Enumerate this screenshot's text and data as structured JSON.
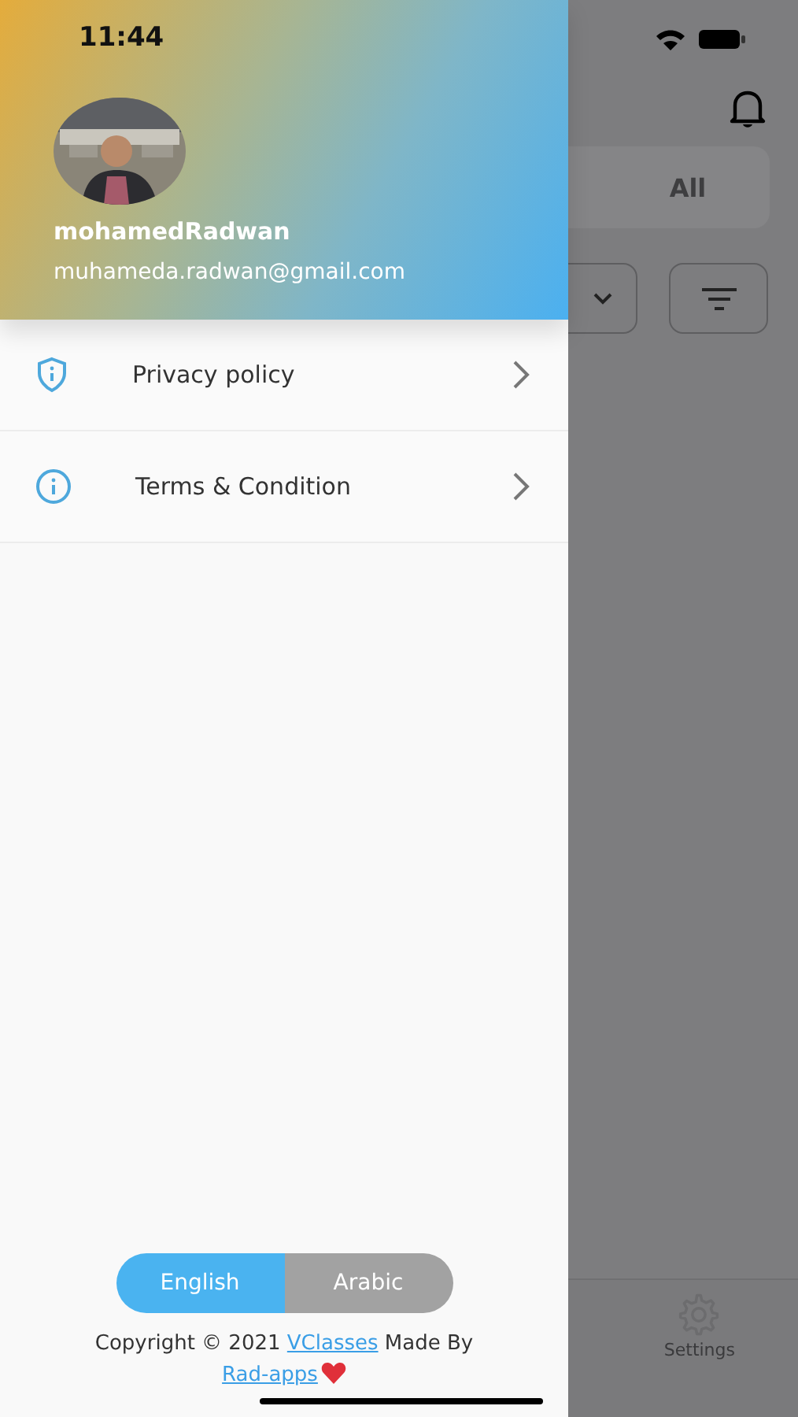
{
  "status_bar": {
    "time": "11:44"
  },
  "profile": {
    "name": "mohamedRadwan",
    "email": "muhameda.radwan@gmail.com"
  },
  "menu": [
    {
      "label": "Privacy policy",
      "kind": "shield"
    },
    {
      "label": "Terms & Condition",
      "kind": "info"
    }
  ],
  "language_toggle": [
    {
      "label": "English",
      "selected": true
    },
    {
      "label": "Arabic",
      "selected": false
    }
  ],
  "footer": {
    "text_before": "Copyright © 2021",
    "link_1": "VClasses",
    "text_middle": "Made By",
    "link_2": "Rad-apps"
  },
  "background_screen": {
    "tab": "All",
    "bottom_nav": [
      {
        "label": "Settings"
      }
    ]
  }
}
